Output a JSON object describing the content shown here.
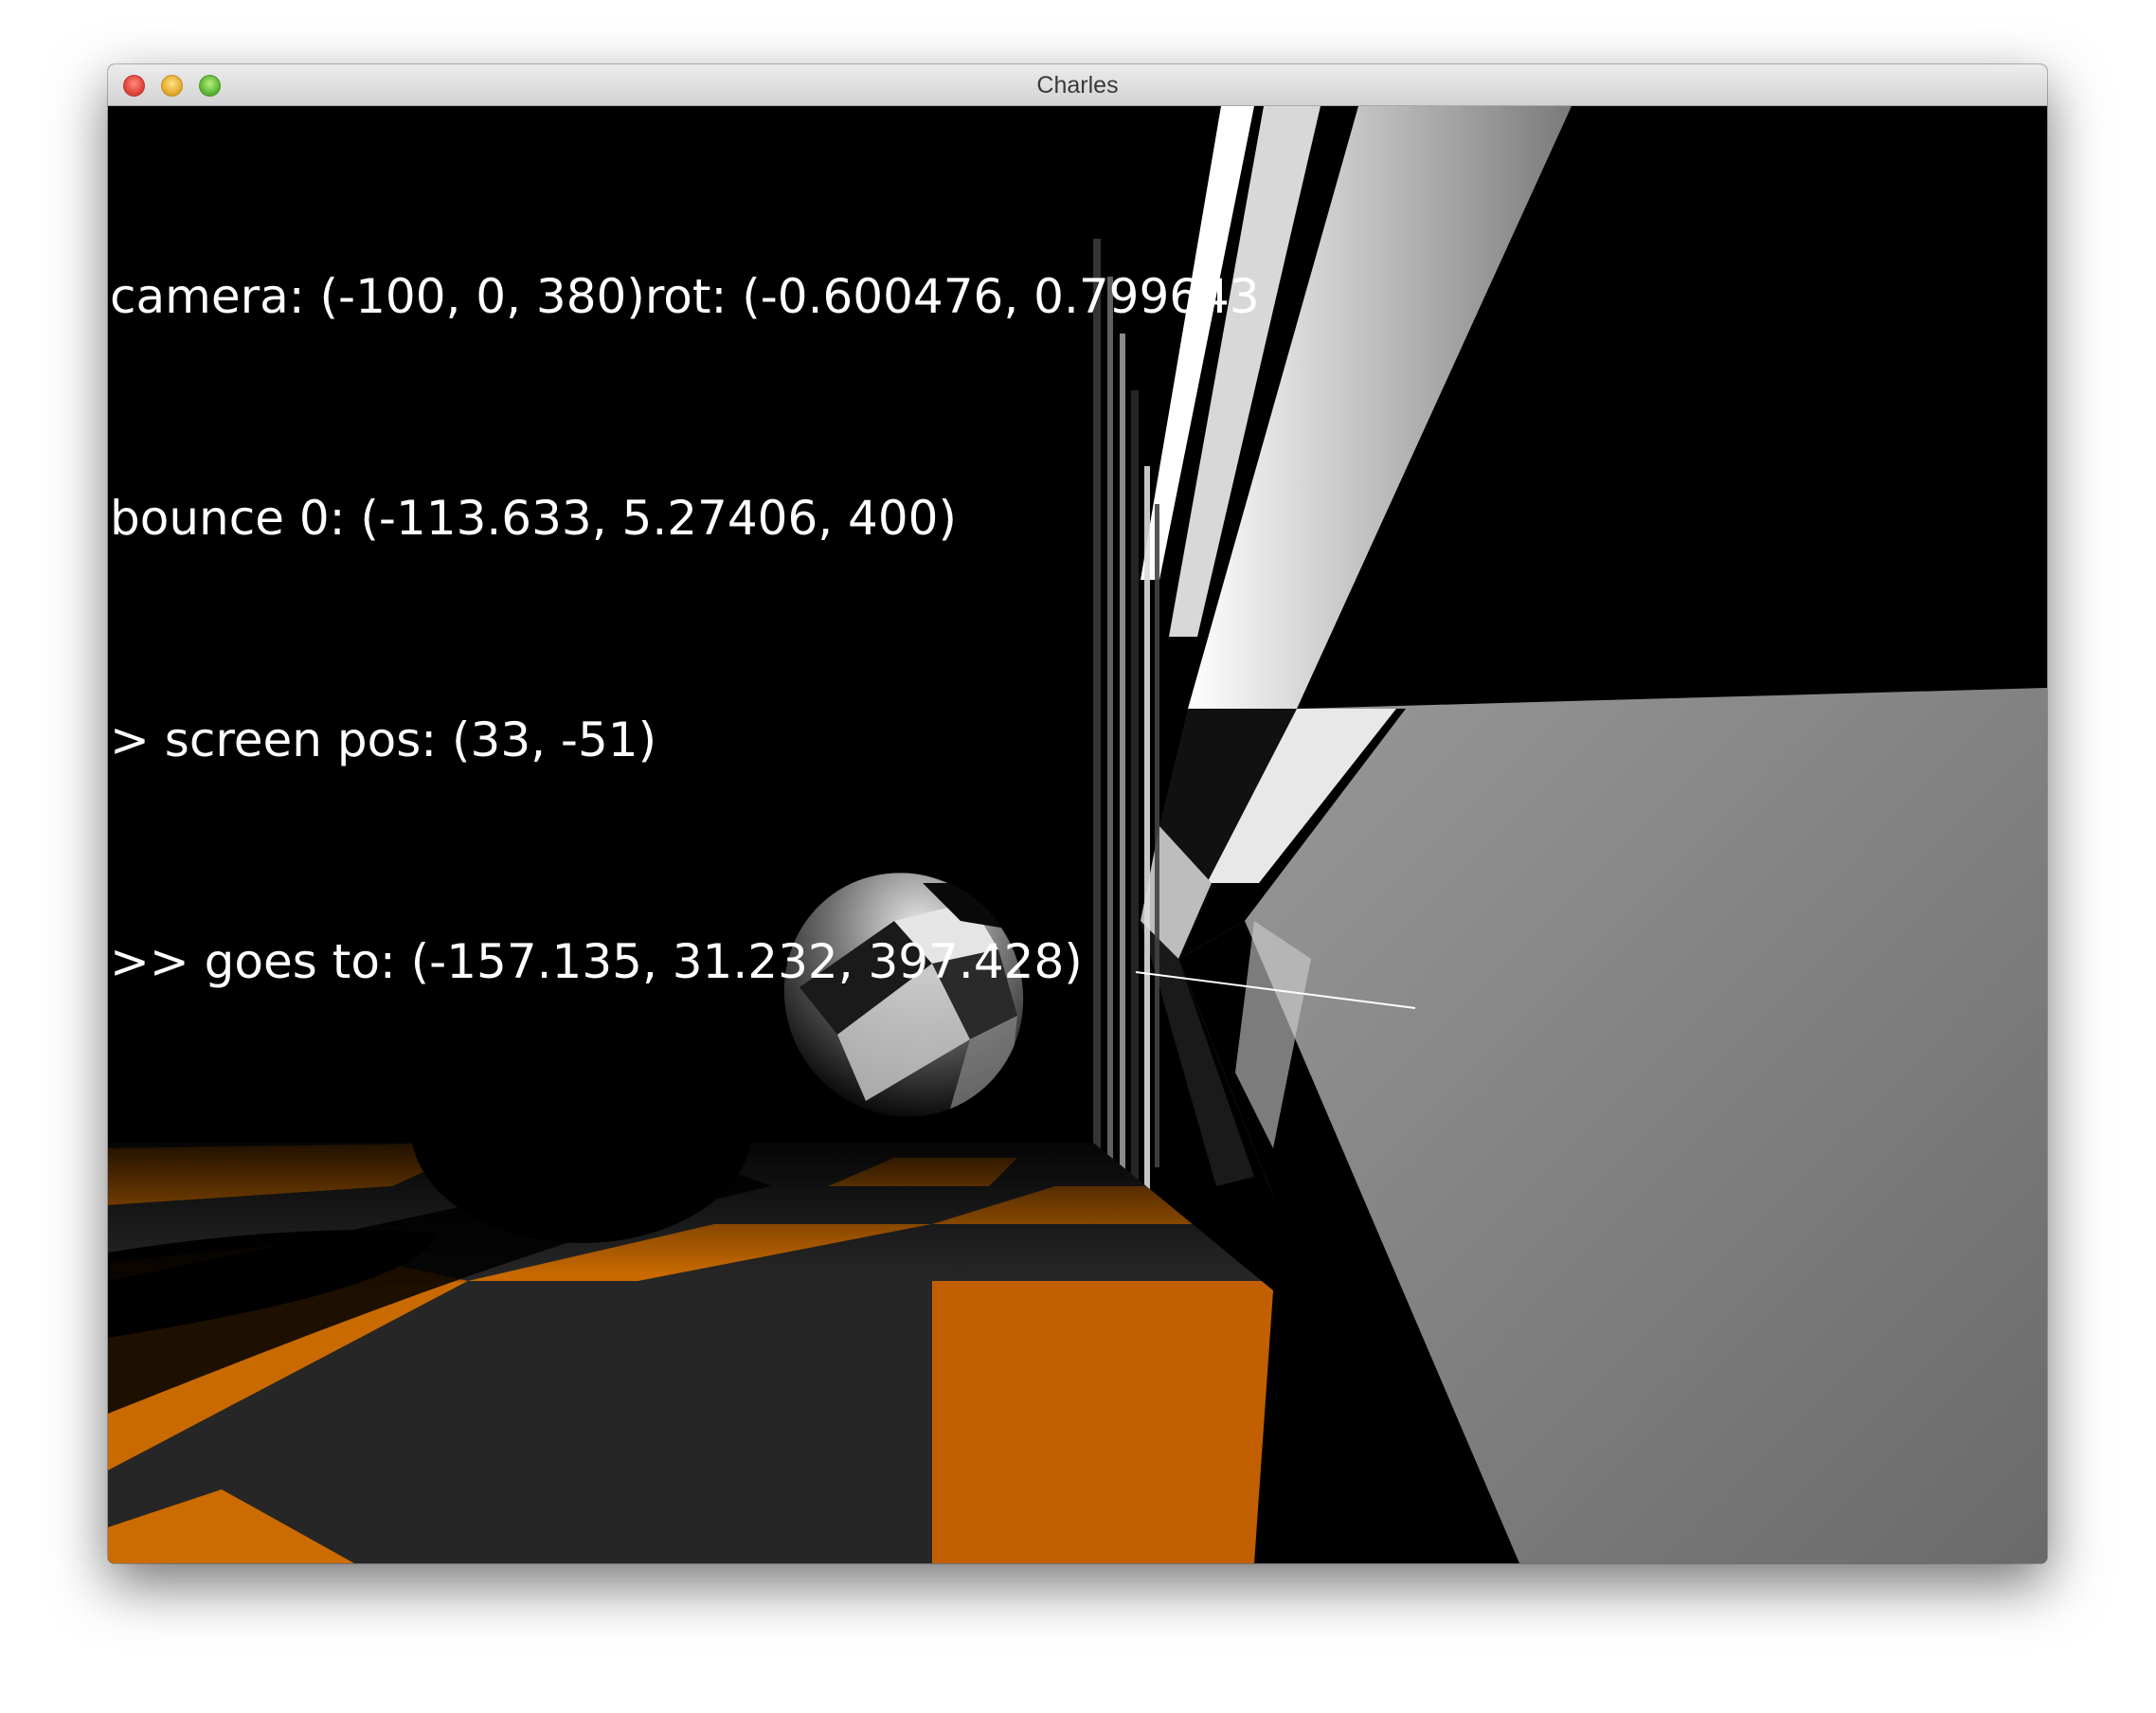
{
  "window": {
    "title": "Charles"
  },
  "hud": {
    "lines": [
      "camera: (-100, 0, 380)rot: (-0.600476, 0.799643",
      "bounce 0: (-113.633, 5.27406, 400)",
      "> screen pos: (33, -51)",
      ">> goes to: (-157.135, 31.232, 397.428)"
    ]
  },
  "colors": {
    "floor_orange": "#c96a00",
    "floor_dark": "#262626",
    "wall_gray": "#8a8a8a",
    "background": "#000000"
  },
  "icons": [
    "close-button",
    "minimize-button",
    "zoom-button"
  ]
}
